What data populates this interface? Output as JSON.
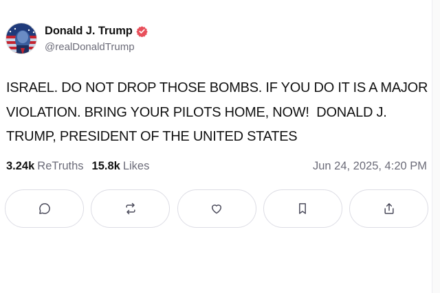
{
  "post": {
    "author": {
      "display_name": "Donald J. Trump",
      "handle": "@realDonaldTrump",
      "verified": true,
      "verified_color": "#e8505b"
    },
    "text": "ISRAEL. DO NOT DROP THOSE BOMBS. IF YOU DO IT IS A MAJOR\nVIOLATION. BRING YOUR PILOTS HOME, NOW!  DONALD J.\nTRUMP, PRESIDENT OF THE UNITED STATES",
    "stats": {
      "retruths_count": "3.24k",
      "retruths_label": "ReTruths",
      "likes_count": "15.8k",
      "likes_label": "Likes"
    },
    "timestamp": "Jun 24, 2025, 4:20 PM"
  },
  "actions": [
    {
      "name": "reply",
      "icon": "reply-icon"
    },
    {
      "name": "retruth",
      "icon": "retruth-icon"
    },
    {
      "name": "like",
      "icon": "heart-icon"
    },
    {
      "name": "bookmark",
      "icon": "bookmark-icon"
    },
    {
      "name": "share",
      "icon": "share-icon"
    }
  ],
  "colors": {
    "text": "#111111",
    "muted": "#6b6b78",
    "border": "#dcdce4",
    "icon": "#4a4a5a"
  }
}
